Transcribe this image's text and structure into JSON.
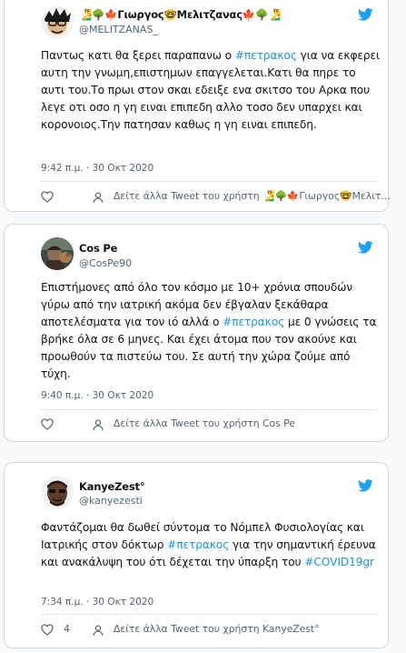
{
  "colors": {
    "accent": "#1da1f2",
    "hashtag": "#1b95e0",
    "muted": "#536471",
    "heart": "#536471"
  },
  "tweets": [
    {
      "name": "🧏‍♂️🌳🍁Γιωργος🤓Μελιτζανας🍁🌳🧏‍♂️",
      "handle": "@MELITZANAS_",
      "avatar_icon": "cartoon-avatar-icon",
      "text_before": "Παντως κατι θα ξερει παραπανω ο ",
      "hashtag": "#πετρακος",
      "text_after": " για να εκφερει αυτη την γνωμη,επιστημων επαγγελεται.Κατι θα πηρε το αυτι του.Το πρωι στον σκαι εδειξε ενα σκιτσο του Αρκα που λεγε οτι οσο η γη ειναι επιπεδη αλλο τοσο δεν υπαρχει και κορονοιος.Την πατησαν καθως η γη ειναι επιπεδη.",
      "hashtag2": "",
      "timestamp": "9:42 π.μ. · 30 Οκτ 2020",
      "likes": "",
      "more_link": "Δείτε άλλα Tweet του χρήστη 🧏‍♂️🌳🍁Γιωργος🤓Μελιτ…"
    },
    {
      "name": "Cos Pe",
      "handle": "@CosPe90",
      "avatar_icon": "photo-avatar-icon",
      "text_before": "Επιστήμονες από όλο τον κόσμο με 10+ χρόνια σπουδών γύρω από την ιατρική ακόμα δεν έβγαλαν ξεκάθαρα αποτελέσματα για τον ιό αλλά ο ",
      "hashtag": "#πετρακος",
      "text_after": " με 0 γνώσεις τα βρήκε όλα σε 6 μηνες. Και έχει άτομα που τον ακούνε και προωθούν τα πιστεύω του. Σε αυτή την χώρα ζούμε από τύχη.",
      "hashtag2": "",
      "timestamp": "9:40 π.μ. · 30 Οκτ 2020",
      "likes": "",
      "more_link": "Δείτε άλλα Tweet του χρήστη Cos Pe"
    },
    {
      "name": "KanyeZest°",
      "handle": "@kanyezesti",
      "avatar_icon": "kanye-avatar-icon",
      "text_before": "Φαντάζομαι θα δωθεί σύντομα το Νόμπελ Φυσιολογίας και Ιατρικής στον δόκτωρ ",
      "hashtag": "#πετρακος",
      "text_after": " για την σημαντική έρευνα και ανακάλυψη του ότι δέχεται την ύπαρξη του ",
      "hashtag2": "#COVID19gr",
      "timestamp": "7:34 π.μ. · 30 Οκτ 2020",
      "likes": "4",
      "more_link": "Δείτε άλλα Tweet του χρήστη KanyeZest°"
    }
  ]
}
